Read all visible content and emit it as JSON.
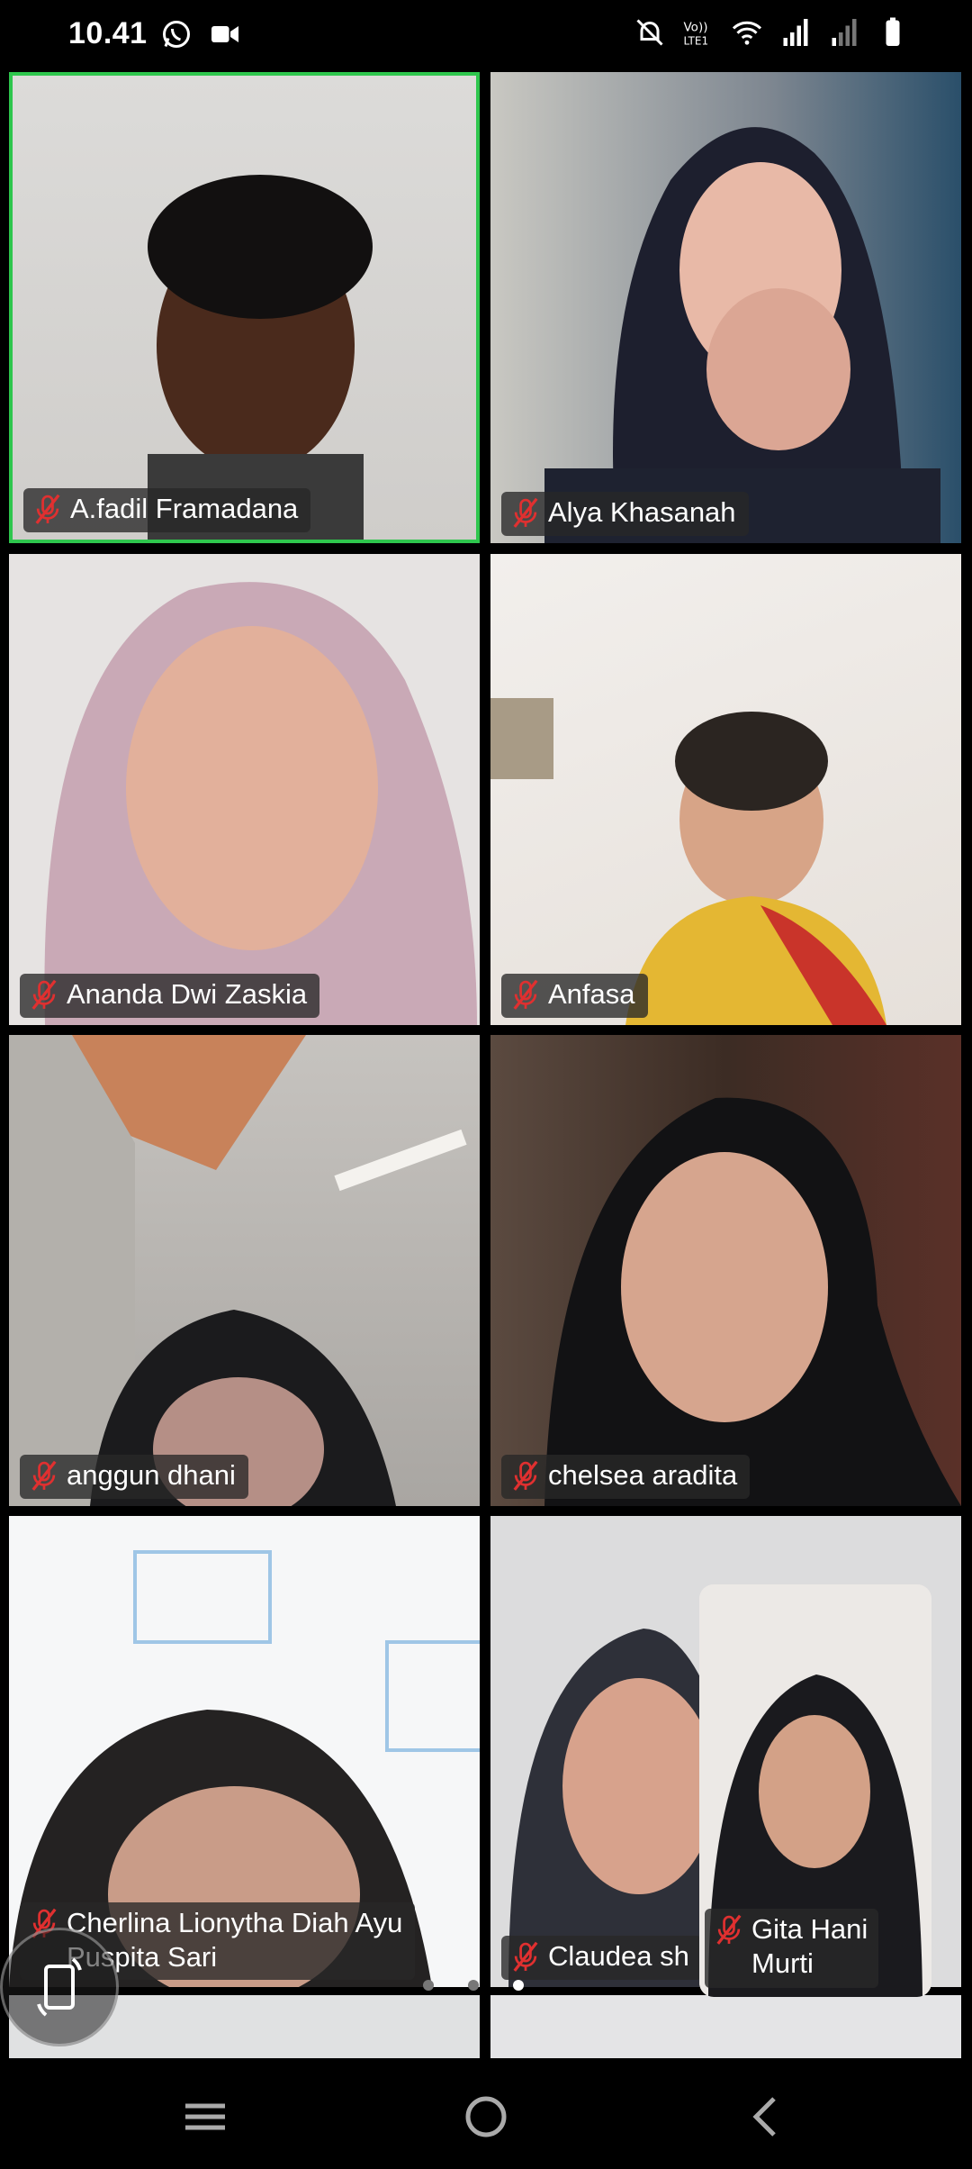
{
  "status_bar": {
    "time": "10.41",
    "left_icons": [
      "whatsapp-icon",
      "video-camera-icon"
    ],
    "right_icons": [
      "mute-bell-icon",
      "volte-icon",
      "wifi-icon",
      "signal-icon",
      "signal-weak-icon",
      "battery-icon"
    ]
  },
  "participants": [
    {
      "name": "A.fadil Framadana",
      "muted": true,
      "active_speaker": true
    },
    {
      "name": "Alya Khasanah",
      "muted": true
    },
    {
      "name": "Ananda Dwi Zaskia",
      "muted": true
    },
    {
      "name": "Anfasa",
      "muted": true
    },
    {
      "name": "anggun dhani",
      "muted": true
    },
    {
      "name": "chelsea aradita",
      "muted": true
    },
    {
      "name_line1": "Cherlina Lionytha Diah Ayu",
      "name_line2": "Puspita Sari",
      "muted": true
    },
    {
      "name": "Claudea sh",
      "muted": true
    }
  ],
  "self_view": {
    "name_line1": "Gita Hani",
    "name_line2": "Murti",
    "muted": true
  },
  "pagination": {
    "pages": 3,
    "current": 3
  },
  "colors": {
    "active_border": "#2ec64d",
    "mic_muted": "#e03030",
    "tag_bg": "#282828"
  },
  "nav": {
    "icons": [
      "recent-apps-icon",
      "home-icon",
      "back-icon"
    ]
  }
}
